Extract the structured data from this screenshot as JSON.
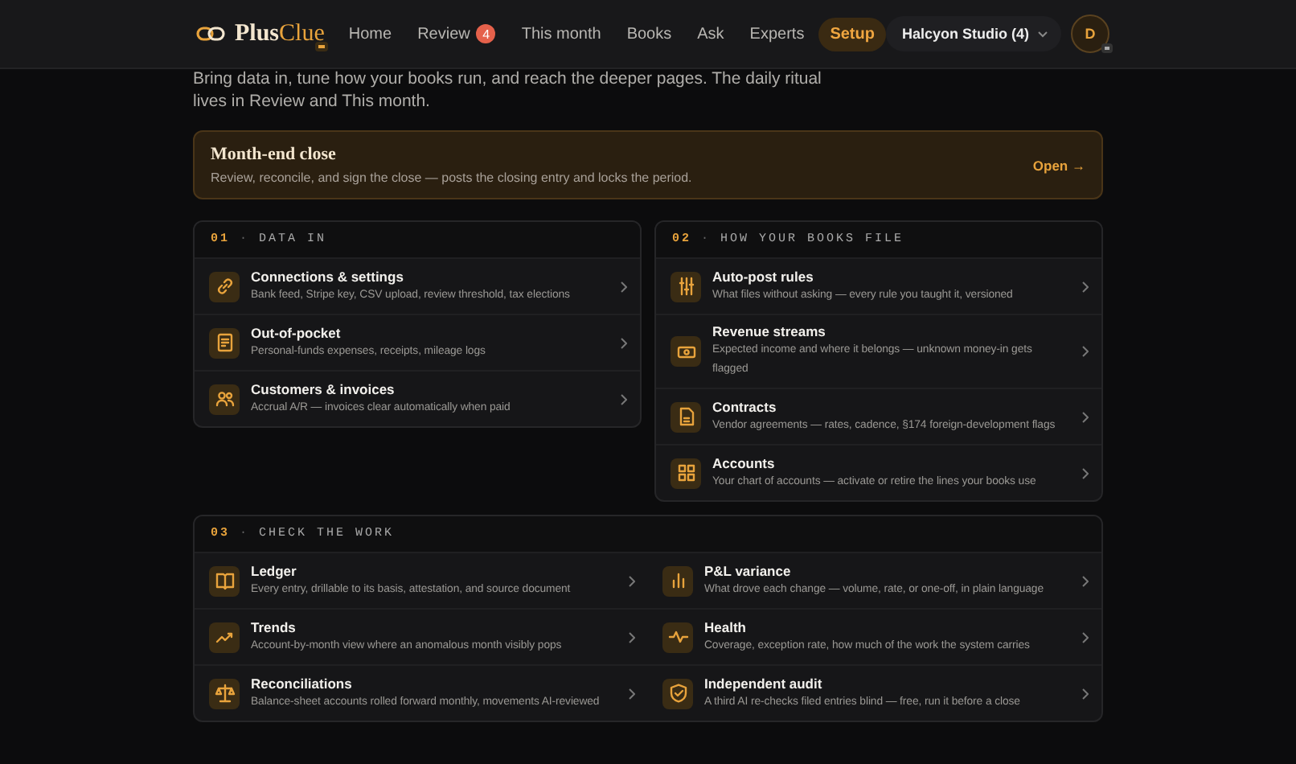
{
  "brand": {
    "name_start": "Plus",
    "name_end": "Clue"
  },
  "nav": [
    {
      "label": "Home",
      "selected": false
    },
    {
      "label": "Review",
      "selected": false,
      "badge": "4"
    },
    {
      "label": "This month",
      "selected": false
    },
    {
      "label": "Books",
      "selected": false
    },
    {
      "label": "Ask",
      "selected": false
    },
    {
      "label": "Experts",
      "selected": false
    },
    {
      "label": "Setup",
      "selected": true
    }
  ],
  "workspace": "Halcyon Studio (4)",
  "avatar": "D",
  "intro": "Bring data in, tune how your books run, and reach the deeper pages. The daily ritual lives in Review and This month.",
  "callout": {
    "title": "Month-end close",
    "text": "Review, reconcile, and sign the close — posts the closing entry and locks the period.",
    "action": "Open →"
  },
  "sections": [
    {
      "number": "01",
      "separator": "·",
      "title": "DATA IN",
      "items": [
        {
          "title": "Connections & settings",
          "text": "Bank feed, Stripe key, CSV upload, review threshold, tax elections"
        },
        {
          "title": "Out-of-pocket",
          "text": "Personal-funds expenses, receipts, mileage logs"
        },
        {
          "title": "Customers & invoices",
          "text": "Accrual A/R — invoices clear automatically when paid"
        }
      ]
    },
    {
      "number": "02",
      "separator": "·",
      "title": "HOW YOUR BOOKS FILE",
      "items": [
        {
          "title": "Auto-post rules",
          "text": "What files without asking — every rule you taught it, versioned"
        },
        {
          "title": "Revenue streams",
          "text": "Expected income and where it belongs — unknown money-in gets flagged"
        },
        {
          "title": "Contracts",
          "text": "Vendor agreements — rates, cadence, §174 foreign-development flags"
        },
        {
          "title": "Accounts",
          "text": "Your chart of accounts — activate or retire the lines your books use"
        }
      ]
    },
    {
      "number": "03",
      "separator": "·",
      "title": "CHECK THE WORK",
      "items": [
        {
          "title": "Ledger",
          "text": "Every entry, drillable to its basis, attestation, and source document"
        },
        {
          "title": "P&L variance",
          "text": "What drove each change — volume, rate, or one-off, in plain language"
        },
        {
          "title": "Trends",
          "text": "Account-by-month view where an anomalous month visibly pops"
        },
        {
          "title": "Health",
          "text": "Coverage, exception rate, how much of the work the system carries"
        },
        {
          "title": "Reconciliations",
          "text": "Balance-sheet accounts rolled forward monthly, movements AI-reviewed"
        },
        {
          "title": "Independent audit",
          "text": "A third AI re-checks filed entries blind — free, run it before a close"
        }
      ]
    }
  ]
}
